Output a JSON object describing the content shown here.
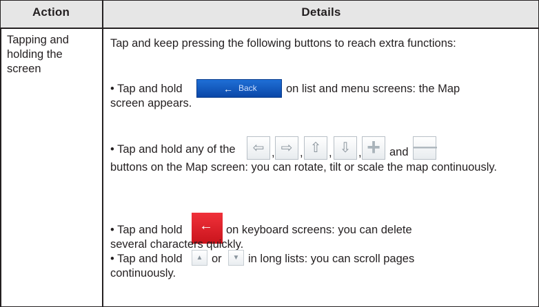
{
  "table": {
    "header": {
      "action": "Action",
      "details": "Details"
    },
    "row": {
      "action": "Tapping and holding the screen",
      "intro": "Tap and keep pressing the following buttons to reach extra functions:",
      "item1": {
        "before": "• Tap and hold",
        "after": "on list and menu screens: the Map",
        "line2": "screen appears.",
        "button_label": "Back",
        "button_icon": "left-arrow-icon"
      },
      "item2": {
        "before": "• Tap and hold any of the",
        "sep1": ",",
        "sep2": ",",
        "sep3": ",",
        "sep4": ",",
        "and": "and",
        "line2": "buttons on the Map screen: you can rotate, tilt or scale the map continuously.",
        "icons": [
          "left-arrow-icon",
          "right-arrow-icon",
          "up-arrow-icon",
          "down-arrow-icon",
          "plus-icon",
          "minus-icon"
        ]
      },
      "item3": {
        "before": "• Tap and hold",
        "after": "on keyboard screens: you can delete",
        "line2": "several characters quickly.",
        "button_icon": "delete-arrow-icon"
      },
      "item4": {
        "before": "• Tap and hold",
        "or": "or",
        "after": "in long lists: you can scroll pages",
        "line2": "continuously.",
        "icons": [
          "scroll-up-icon",
          "scroll-down-icon"
        ]
      }
    }
  },
  "colors": {
    "header_background": "#e6e6e6",
    "border": "#231f20",
    "back_button": "#0a47a8",
    "delete_button": "#e0232b"
  }
}
